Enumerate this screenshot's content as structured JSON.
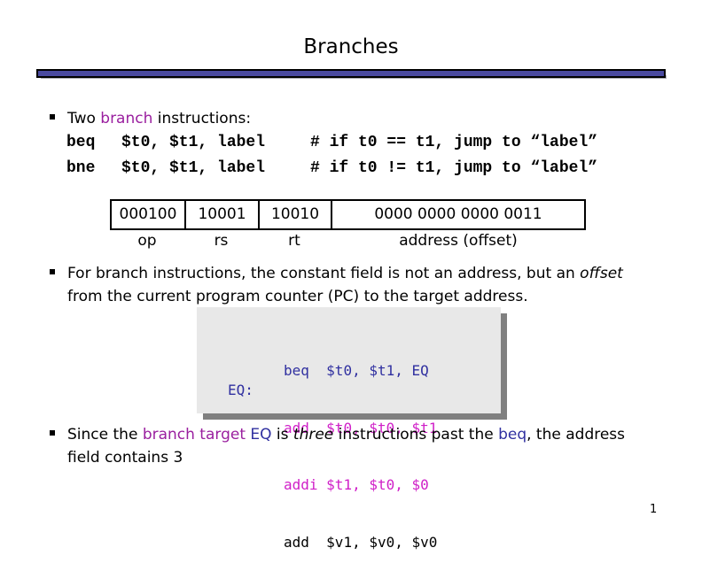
{
  "slide": {
    "title": "Branches",
    "page_number": "1",
    "colors": {
      "accent_purple": "#9a1f9f",
      "accent_blue": "#3030a0",
      "accent_magenta": "#d020c8",
      "rule": "#4a4aa0"
    }
  },
  "bullet1": {
    "prefix": "Two ",
    "highlight": "branch",
    "suffix": " instructions:",
    "lines": [
      {
        "op": "beq",
        "args": "$t0, $t1, label",
        "comment": "# if t0 == t1, jump to “label”"
      },
      {
        "op": "bne",
        "args": "$t0, $t1, label",
        "comment": "# if t0 != t1, jump to “label”"
      }
    ]
  },
  "encoding": {
    "fields": [
      {
        "value": "000100",
        "label": "op"
      },
      {
        "value": "10001",
        "label": "rs"
      },
      {
        "value": "10010",
        "label": "rt"
      },
      {
        "value": "0000 0000 0000 0011",
        "label": "address (offset)"
      }
    ]
  },
  "bullet2": {
    "line1_pre": "For branch instructions, the constant field is not an address, but an ",
    "line1_em": "offset",
    "line2": "from the current program counter (PC) to the target address."
  },
  "code": {
    "label": "EQ:",
    "lines": [
      {
        "op": "beq ",
        "args": "$t0, $t1, EQ"
      },
      {
        "op": "add ",
        "args": "$t0, $t0, $t1"
      },
      {
        "op": "addi",
        "args": "$t1, $t0, $0"
      },
      {
        "op": "add ",
        "args": "$v1, $v0, $v0"
      }
    ]
  },
  "bullet3": {
    "pre": "Since the ",
    "branch_target": "branch target",
    "eq": "EQ",
    "mid": " is ",
    "em": "three",
    "mid2": " instructions past the ",
    "beq": "beq",
    "post": ", the address",
    "line2": "field contains 3"
  }
}
